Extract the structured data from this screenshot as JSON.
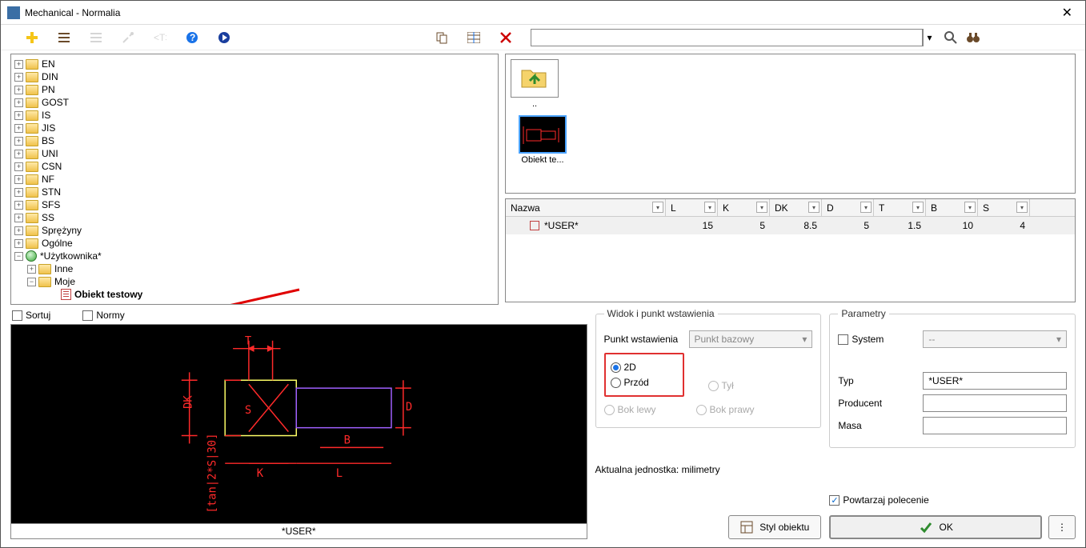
{
  "window": {
    "title": "Mechanical - Normalia"
  },
  "tree": {
    "roots": [
      "EN",
      "DIN",
      "PN",
      "GOST",
      "IS",
      "JIS",
      "BS",
      "UNI",
      "CSN",
      "NF",
      "STN",
      "SFS",
      "SS",
      "Sprężyny",
      "Ogólne"
    ],
    "user_root": "*Użytkownika*",
    "user_children": [
      "Inne",
      "Moje"
    ],
    "leaf": "Obiekt testowy"
  },
  "thumbs": {
    "up_label": "..",
    "obj_label": "Obiekt te..."
  },
  "table": {
    "headers": {
      "nazwa": "Nazwa",
      "L": "L",
      "K": "K",
      "DK": "DK",
      "D": "D",
      "T": "T",
      "B": "B",
      "S": "S"
    },
    "row": {
      "name": "*USER*",
      "L": "15",
      "K": "5",
      "DK": "8.5",
      "D": "5",
      "T": "1.5",
      "B": "10",
      "S": "4"
    }
  },
  "sort": {
    "sortuj": "Sortuj",
    "normy": "Normy"
  },
  "preview_caption": "*USER*",
  "cad_labels": {
    "T": "T",
    "B": "B",
    "D": "D",
    "K": "K",
    "L": "L",
    "S": "S",
    "DK": "DK",
    "formula": "[tan|2*S|30]"
  },
  "view": {
    "legend": "Widok i punkt wstawienia",
    "pkt": "Punkt wstawienia",
    "pkt_bazowy": "Punkt bazowy",
    "r2d": "2D",
    "przod": "Przód",
    "tyl": "Tył",
    "boklewy": "Bok lewy",
    "bokprawy": "Bok prawy"
  },
  "params": {
    "legend": "Parametry",
    "system": "System",
    "system_val": "--",
    "typ": "Typ",
    "typ_val": "*USER*",
    "producent": "Producent",
    "masa": "Masa"
  },
  "bottom": {
    "unit": "Aktualna jednostka: milimetry",
    "styl": "Styl obiektu",
    "repeat": "Powtarzaj polecenie",
    "ok": "OK"
  }
}
